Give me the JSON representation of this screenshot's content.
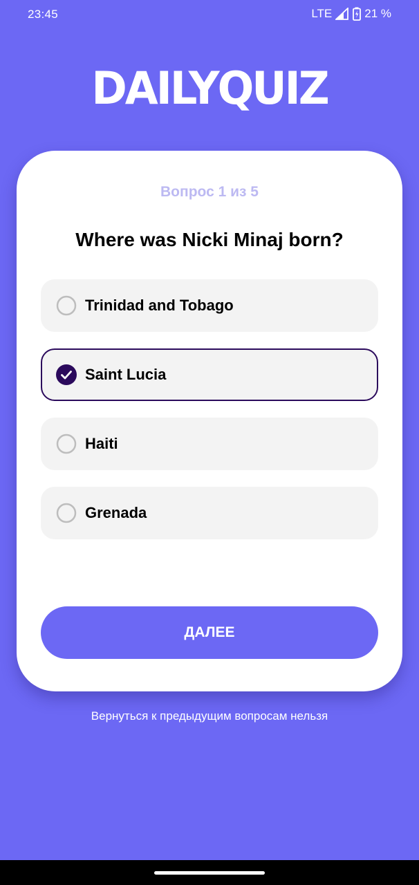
{
  "status_bar": {
    "time": "23:45",
    "network": "LTE",
    "battery": "21 %",
    "icons": [
      "signal-icon",
      "battery-charging-icon"
    ]
  },
  "logo": {
    "text": "DAILYQUIZ"
  },
  "quiz": {
    "progress": "Вопрос 1 из 5",
    "question": "Where was Nicki Minaj born?",
    "options": [
      {
        "label": "Trinidad and Tobago",
        "selected": false
      },
      {
        "label": "Saint Lucia",
        "selected": true
      },
      {
        "label": "Haiti",
        "selected": false
      },
      {
        "label": "Grenada",
        "selected": false
      }
    ],
    "next_label": "ДАЛЕЕ"
  },
  "footnote": "Вернуться к предыдущим вопросам нельзя",
  "colors": {
    "background": "#6C68F4",
    "card": "#FFFFFF",
    "option_bg": "#F3F3F3",
    "selected_accent": "#2B0A5C",
    "progress_text": "#BCB9F2"
  }
}
